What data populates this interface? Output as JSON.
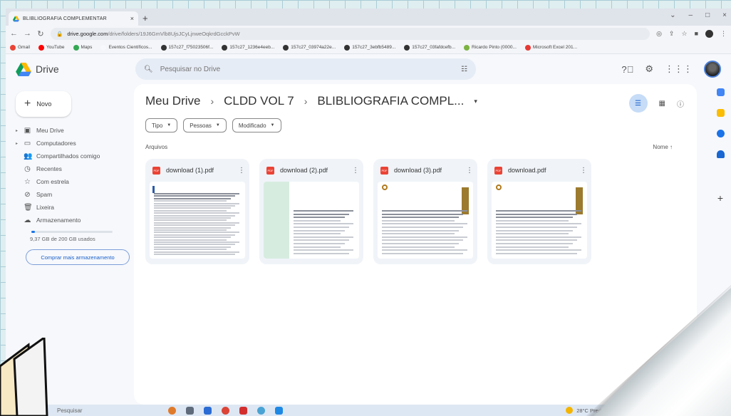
{
  "browser": {
    "tab_title": "BLIBLIOGRAFIA COMPLEMENTAR",
    "url_host": "drive.google.com",
    "url_path": "/drive/folders/19J6GmVlb8UjsJCyLjnweOqkrdGcckPvW",
    "bookmarks": [
      {
        "label": "Gmail",
        "color": "#ea4335"
      },
      {
        "label": "YouTube",
        "color": "#ff0000"
      },
      {
        "label": "Maps",
        "color": "#34a853"
      },
      {
        "label": "Eventos Científicos...",
        "color": "#f6f8fc"
      },
      {
        "label": "157c27_f75023506f...",
        "color": "#333333"
      },
      {
        "label": "157c27_1236e4eeb...",
        "color": "#333333"
      },
      {
        "label": "157c27_03974a22e...",
        "color": "#333333"
      },
      {
        "label": "157c27_3ebfb5489...",
        "color": "#333333"
      },
      {
        "label": "157c27_03fafdcefb...",
        "color": "#333333"
      },
      {
        "label": "Ricardo Pinto (0000...",
        "color": "#7cb342"
      },
      {
        "label": "Microsoft Excel 201...",
        "color": "#e53935"
      }
    ]
  },
  "drive": {
    "logo_text": "Drive",
    "search_placeholder": "Pesquisar no Drive",
    "new_label": "Novo",
    "nav": [
      {
        "label": "Meu Drive",
        "icon": "drive-icon",
        "glyph": "▣",
        "caret": true
      },
      {
        "label": "Computadores",
        "icon": "computer-icon",
        "glyph": "▭",
        "caret": true
      },
      {
        "label": "Compartilhados comigo",
        "icon": "shared-icon",
        "glyph": "👥",
        "caret": false
      },
      {
        "label": "Recentes",
        "icon": "clock-icon",
        "glyph": "◷",
        "caret": false
      },
      {
        "label": "Com estrela",
        "icon": "star-icon",
        "glyph": "☆",
        "caret": false
      },
      {
        "label": "Spam",
        "icon": "spam-icon",
        "glyph": "⊘",
        "caret": false
      },
      {
        "label": "Lixeira",
        "icon": "trash-icon",
        "glyph": "🗑",
        "caret": false
      },
      {
        "label": "Armazenamento",
        "icon": "cloud-icon",
        "glyph": "☁",
        "caret": false
      }
    ],
    "storage_used_fraction": 0.047,
    "storage_text": "9,37 GB de 200 GB usados",
    "buy_storage_label": "Comprar mais armazenamento",
    "breadcrumb": [
      "Meu Drive",
      "CLDD VOL 7",
      "BLIBLIOGRAFIA COMPL..."
    ],
    "filters": [
      "Tipo",
      "Pessoas",
      "Modificado"
    ],
    "section_label": "Arquivos",
    "sort_label": "Nome",
    "files": [
      {
        "name": "download (1).pdf"
      },
      {
        "name": "download (2).pdf"
      },
      {
        "name": "download (3).pdf"
      },
      {
        "name": "download.pdf"
      }
    ]
  },
  "taskbar": {
    "search_label": "Pesquisar",
    "weather": "28°C Pred. limpo"
  },
  "colors": {
    "accent": "#1a73e8",
    "pdf": "#ea4335"
  }
}
